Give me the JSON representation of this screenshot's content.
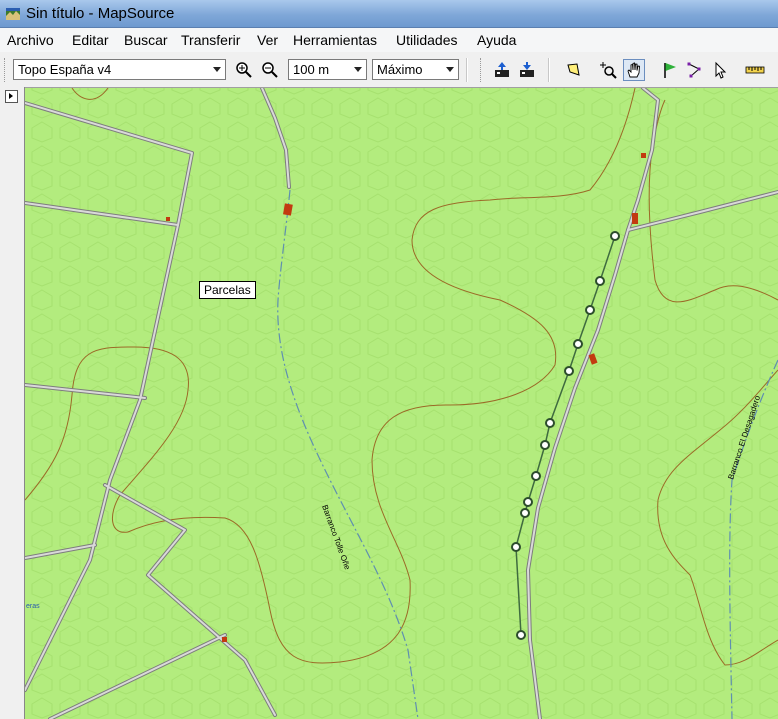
{
  "window": {
    "title": "Sin título - MapSource"
  },
  "menu": {
    "items": [
      "Archivo",
      "Editar",
      "Buscar",
      "Transferir",
      "Ver",
      "Herramientas",
      "Utilidades",
      "Ayuda"
    ]
  },
  "toolbar": {
    "map_product": "Topo España v4",
    "zoom_scale": "100 m",
    "detail_level": "Máximo",
    "buttons": [
      "zoom-in-icon",
      "zoom-out-icon",
      "receive-from-device-icon",
      "send-to-device-icon",
      "map-select-icon",
      "zoom-tool-icon",
      "hand-tool-icon",
      "waypoint-flag-icon",
      "route-tool-icon",
      "selection-arrow-icon",
      "measure-ruler-icon"
    ]
  },
  "map": {
    "label_parcelas": "Parcelas",
    "road_label_1": "Barranco Tolle Oñe",
    "road_label_2": "Barranco El Desagadero",
    "edge_label": "eras",
    "colors": {
      "land": "#b3ec7e",
      "contour": "#9b6a27",
      "road": "#7d7d7d",
      "track": "#5a7a5a",
      "building": "#c23a10"
    },
    "track_points_count": 11
  }
}
